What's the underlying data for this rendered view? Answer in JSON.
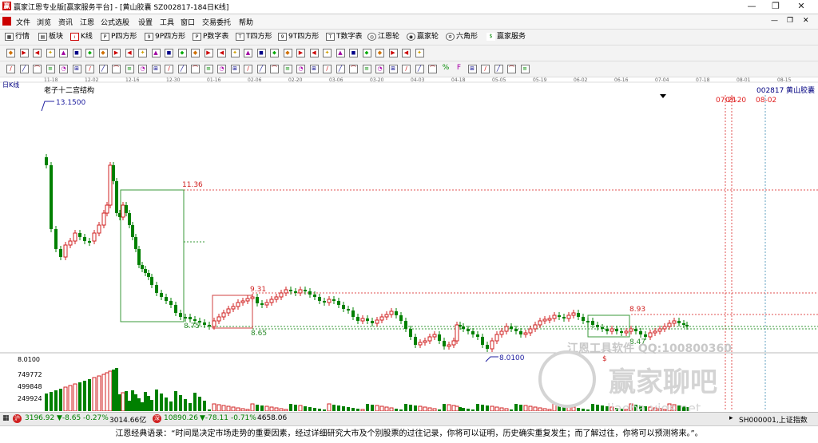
{
  "window": {
    "title": "赢家江恩专业版[赢家服务平台] - [黄山胶囊  SZ002817-184日K线]",
    "minimize": "—",
    "restore": "❐",
    "close": "✕"
  },
  "menu": [
    "文件",
    "浏览",
    "资讯",
    "江恩",
    "公式选股",
    "设置",
    "工具",
    "窗口",
    "交易委托",
    "帮助"
  ],
  "menu_mdi": {
    "minimize": "—",
    "restore": "❐",
    "close": "✕"
  },
  "toolbar1": [
    "行情",
    "板块",
    "K线",
    "P四方形",
    "9P四方形",
    "P数字表",
    "T四方形",
    "9T四方形",
    "T数字表",
    "江恩轮",
    "赢家轮",
    "六角形",
    "赢家服务"
  ],
  "toolbar1_icons": [
    "grid-icon",
    "blocks-icon",
    "candle-icon",
    "p-square-icon",
    "9p-square-icon",
    "p-table-icon",
    "t-square-icon",
    "9t-square-icon",
    "t-table-icon",
    "gann-wheel-icon",
    "winner-wheel-icon",
    "hexagon-icon",
    "dollar-icon"
  ],
  "toolbar3_text": {
    "percent": "%",
    "fib": "F"
  },
  "chart": {
    "period_label": "日K线",
    "indicator_label": "老子十二宫结构",
    "stock_code": "002817",
    "stock_name": "黄山胶囊",
    "x_ticks": [
      "11-18",
      "12-02",
      "12-16",
      "12-30",
      "01-16",
      "02-06",
      "02-20",
      "03-06",
      "03-20",
      "04-03",
      "04-18",
      "05-05",
      "05-19",
      "06-02",
      "06-16",
      "07-04",
      "07-18",
      "08-01",
      "08-15"
    ],
    "marker_07_21": "07-21",
    "marker_08_02": "08-02",
    "marker_07_20": "07-20",
    "high_label": "13.1500",
    "low_label": "8.0100",
    "label_1136": "11.36",
    "label_931": "9.31",
    "label_865": "8.65",
    "label_875": "8.75",
    "label_893": "8.93",
    "label_847": "8.47",
    "label_dollar": "$",
    "price_8010": "8.0100",
    "vol_labels": [
      "749772",
      "499848",
      "249924"
    ],
    "watermark_tool": "江恩工具软件 QQ:100800360",
    "watermark_brand": "赢家聊吧",
    "watermark_url": "liaoba.yjgs.net"
  },
  "status": {
    "sh_index": "3196.92",
    "sh_change": "▼-8.65",
    "sh_pct": "-0.27%",
    "sh_amount": "3014.66亿",
    "sz_index": "10890.26",
    "sz_change": "▼-78.11",
    "sz_pct": "-0.71%",
    "sz_amount": "4658.06",
    "right": "SH000001,上证指数"
  },
  "quote": "江恩经典语录：“时间是决定市场走势的重要因素，经过详细研究大市及个别股票的过往记录，你将可以证明，历史确实重复发生；而了解过往，你将可以预测将来。”。"
}
